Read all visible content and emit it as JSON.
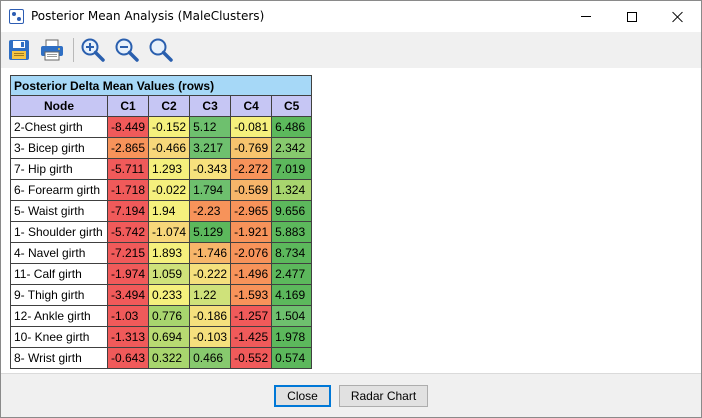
{
  "window": {
    "title": "Posterior Mean Analysis (MaleClusters)"
  },
  "toolbar": {
    "icons": [
      "save-icon",
      "print-icon",
      "zoom-in-icon",
      "zoom-out-icon",
      "zoom-fit-icon"
    ]
  },
  "table": {
    "caption": "Posterior Delta Mean Values (rows)",
    "header_node": "Node",
    "columns": [
      "C1",
      "C2",
      "C3",
      "C4",
      "C5"
    ],
    "rows": [
      {
        "node": "2-Chest girth",
        "values": [
          "-8.449",
          "-0.152",
          "5.12",
          "-0.081",
          "6.486"
        ],
        "colors": [
          "#f05a5a",
          "#f5f07d",
          "#6ec06e",
          "#f5f07d",
          "#5cb85c"
        ]
      },
      {
        "node": "3- Bicep girth",
        "values": [
          "-2.865",
          "-0.466",
          "3.217",
          "-0.769",
          "2.342"
        ],
        "colors": [
          "#f7935a",
          "#f7d77a",
          "#6ec06e",
          "#f7c46e",
          "#87c96e"
        ]
      },
      {
        "node": "7- Hip girth",
        "values": [
          "-5.711",
          "1.293",
          "-0.343",
          "-2.272",
          "7.019"
        ],
        "colors": [
          "#f05a5a",
          "#f5f07d",
          "#f7e17d",
          "#f7935a",
          "#5cb85c"
        ]
      },
      {
        "node": "6- Forearm girth",
        "values": [
          "-1.718",
          "-0.022",
          "1.794",
          "-0.569",
          "1.324"
        ],
        "colors": [
          "#f05a5a",
          "#f5f07d",
          "#6ec06e",
          "#f7b56a",
          "#a8d56e"
        ]
      },
      {
        "node": "5- Waist girth",
        "values": [
          "-7.194",
          "1.94",
          "-2.23",
          "-2.965",
          "9.656"
        ],
        "colors": [
          "#f05a5a",
          "#f5f07d",
          "#f7935a",
          "#f7935a",
          "#5cb85c"
        ]
      },
      {
        "node": "1- Shoulder girth",
        "values": [
          "-5.742",
          "-1.074",
          "5.129",
          "-1.921",
          "5.883"
        ],
        "colors": [
          "#f05a5a",
          "#f7d77a",
          "#5cb85c",
          "#f7935a",
          "#5cb85c"
        ]
      },
      {
        "node": "4- Navel girth",
        "values": [
          "-7.215",
          "1.893",
          "-1.746",
          "-2.076",
          "8.734"
        ],
        "colors": [
          "#f05a5a",
          "#f5f07d",
          "#f7b56a",
          "#f7935a",
          "#5cb85c"
        ]
      },
      {
        "node": "11- Calf girth",
        "values": [
          "-1.974",
          "1.059",
          "-0.222",
          "-1.496",
          "2.477"
        ],
        "colors": [
          "#f05a5a",
          "#cfe27a",
          "#f5e07d",
          "#f7935a",
          "#5cb85c"
        ]
      },
      {
        "node": "9- Thigh girth",
        "values": [
          "-3.494",
          "0.233",
          "1.22",
          "-1.593",
          "4.169"
        ],
        "colors": [
          "#f05a5a",
          "#f5f07d",
          "#cfe27a",
          "#f7935a",
          "#5cb85c"
        ]
      },
      {
        "node": "12- Ankle girth",
        "values": [
          "-1.03",
          "0.776",
          "-0.186",
          "-1.257",
          "1.504"
        ],
        "colors": [
          "#f05a5a",
          "#a8d56e",
          "#f5e07d",
          "#f05a5a",
          "#6ec06e"
        ]
      },
      {
        "node": "10- Knee girth",
        "values": [
          "-1.313",
          "0.694",
          "-0.103",
          "-1.425",
          "1.978"
        ],
        "colors": [
          "#f05a5a",
          "#b8da72",
          "#f5e07d",
          "#f05a5a",
          "#5cb85c"
        ]
      },
      {
        "node": "8- Wrist girth",
        "values": [
          "-0.643",
          "0.322",
          "0.466",
          "-0.552",
          "0.574"
        ],
        "colors": [
          "#f05a5a",
          "#a8d56e",
          "#87c96e",
          "#f05a5a",
          "#5cb85c"
        ]
      }
    ]
  },
  "buttons": {
    "close": "Close",
    "radar": "Radar Chart"
  }
}
